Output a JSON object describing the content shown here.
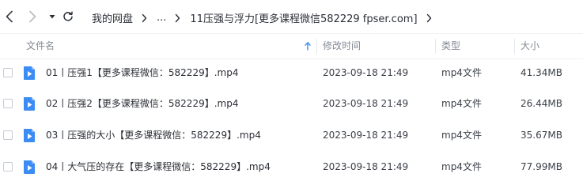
{
  "nav": {
    "back_icon": "chevron-left-icon",
    "forward_icon": "chevron-right-icon",
    "history_icon": "caret-down-icon",
    "refresh_icon": "refresh-icon"
  },
  "breadcrumb": {
    "root": "我的网盘",
    "ellipsis": "...",
    "current": "11压强与浮力[更多课程微信582229 fpser.com]"
  },
  "columns": {
    "name": "文件名",
    "modified": "修改时间",
    "type": "类型",
    "size": "大小"
  },
  "sort": {
    "column": "name",
    "direction": "ascending"
  },
  "colors": {
    "video_icon": "#3b8cf5",
    "header_text": "#848a94"
  },
  "files": [
    {
      "name": "01丨压强1【更多课程微信：582229】.mp4",
      "modified": "2023-09-18 21:49",
      "type": "mp4文件",
      "size": "41.34MB",
      "icon": "video-file-icon"
    },
    {
      "name": "02丨压强2【更多课程微信：582229】.mp4",
      "modified": "2023-09-18 21:49",
      "type": "mp4文件",
      "size": "26.44MB",
      "icon": "video-file-icon"
    },
    {
      "name": "03丨压强的大小【更多课程微信：582229】.mp4",
      "modified": "2023-09-18 21:49",
      "type": "mp4文件",
      "size": "35.67MB",
      "icon": "video-file-icon"
    },
    {
      "name": "04丨大气压的存在【更多课程微信：582229】.mp4",
      "modified": "2023-09-18 21:49",
      "type": "mp4文件",
      "size": "77.99MB",
      "icon": "video-file-icon"
    }
  ]
}
